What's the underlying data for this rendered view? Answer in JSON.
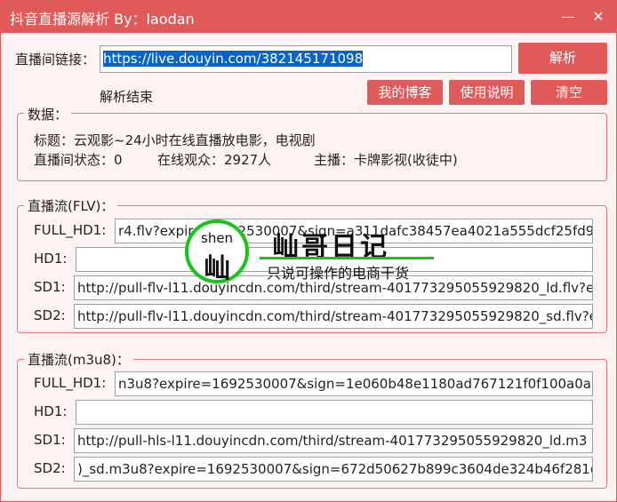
{
  "window": {
    "title": "抖音直播源解析 By：laodan",
    "minimize_glyph": "—",
    "close_glyph": "✕"
  },
  "url_row": {
    "label": "直播间链接：",
    "value": "https://live.douyin.com/382145171098",
    "parse_button": "解析"
  },
  "status_text": "解析结束",
  "buttons": {
    "blog": "我的博客",
    "help": "使用说明",
    "clear": "清空"
  },
  "data_group": {
    "title": "数据：",
    "title_label": "标题：云观影~24小时在线直播放电影，电视剧",
    "room_status": "直播间状态：0",
    "viewers": "在线观众：2927人",
    "host": "主播：卡牌影视(收徒中)"
  },
  "flv_group": {
    "title": "直播流(FLV)：",
    "rows": [
      {
        "label": "FULL_HD1:",
        "value": "r4.flv?expire=1692530007&sign=a311dafc38457ea4021a555dcf25fd99"
      },
      {
        "label": "HD1:",
        "value": ""
      },
      {
        "label": "SD1:",
        "value": "http://pull-flv-l11.douyincdn.com/third/stream-401773295055929820_ld.flv?e"
      },
      {
        "label": "SD2:",
        "value": "http://pull-flv-l11.douyincdn.com/third/stream-401773295055929820_sd.flv?e"
      }
    ]
  },
  "m3u8_group": {
    "title": "直播流(m3u8)：",
    "rows": [
      {
        "label": "FULL_HD1:",
        "value": "n3u8?expire=1692530007&sign=1e060b48e1180ad767121f0f100a0a76"
      },
      {
        "label": "HD1:",
        "value": ""
      },
      {
        "label": "SD1:",
        "value": "http://pull-hls-l11.douyincdn.com/third/stream-401773295055929820_ld.m3"
      },
      {
        "label": "SD2:",
        "value": ")_sd.m3u8?expire=1692530007&sign=672d50627b899c3604de324b46f281dc"
      }
    ]
  },
  "watermark": {
    "circle_text": "shen",
    "circle_char": "屾",
    "main_text": "屾哥日记",
    "sub_text": "只说可操作的电商干货"
  },
  "colors": {
    "accent": "#e05a5a",
    "window_bg": "#fdf3f3",
    "selection": "#0a64c8",
    "watermark_green": "#17c517"
  }
}
